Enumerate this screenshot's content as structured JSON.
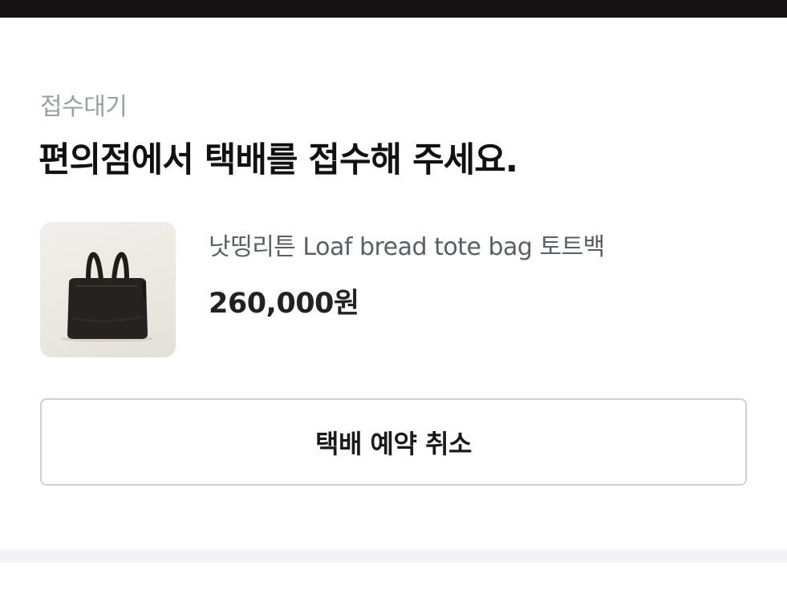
{
  "status": {
    "label": "접수대기",
    "headline": "편의점에서 택배를 접수해 주세요."
  },
  "product": {
    "name": "낫띵리튼 Loaf bread tote bag 토트백",
    "price": "260,000원",
    "image_icon": "black-leather-tote-bag"
  },
  "actions": {
    "cancel_label": "택배 예약 취소"
  },
  "colors": {
    "top_bar": "#141213",
    "status_label": "#9a9ea5",
    "headline": "#111111",
    "product_name": "#5a5e66",
    "button_border": "#cfd1d4",
    "divider": "#f2f3f5"
  }
}
